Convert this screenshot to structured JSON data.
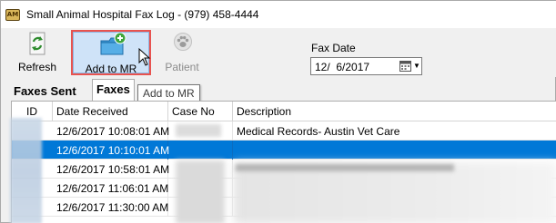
{
  "window": {
    "title": "Small Animal Hospital Fax Log - (979) 458-4444",
    "icon": "hospital-logo-icon"
  },
  "toolbar": {
    "refresh_label": "Refresh",
    "add_to_mr_label": "Add to MR",
    "patient_label": "Patient",
    "refresh_icon": "refresh-icon",
    "add_icon": "folder-add-icon",
    "patient_icon": "paw-icon"
  },
  "fax_date": {
    "label": "Fax Date",
    "value": "12/  6/2017"
  },
  "tabs": [
    {
      "label": "Faxes Sent",
      "active": false
    },
    {
      "label": "Faxes",
      "active": true
    }
  ],
  "tooltip": "Add to MR",
  "grid": {
    "columns": [
      "ID",
      "Date Received",
      "Case No",
      "Description"
    ],
    "rows": [
      {
        "date_received": "12/6/2017 10:08:01 AM",
        "description": "Medical Records- Austin Vet Care",
        "selected": false
      },
      {
        "date_received": "12/6/2017 10:10:01 AM",
        "description": "",
        "selected": true
      },
      {
        "date_received": "12/6/2017 10:58:01 AM",
        "description": "",
        "selected": false
      },
      {
        "date_received": "12/6/2017 11:06:01 AM",
        "description": "",
        "selected": false
      },
      {
        "date_received": "12/6/2017 11:30:00 AM",
        "description": "",
        "selected": false
      }
    ]
  },
  "colors": {
    "selection": "#0078d7",
    "highlight_border": "#e8534f",
    "add_button_bg": "#cfe3f8"
  }
}
